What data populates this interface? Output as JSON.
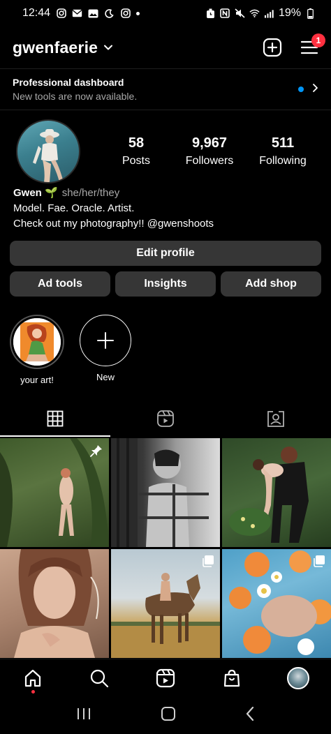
{
  "status_bar": {
    "time": "12:44",
    "battery": "19%"
  },
  "header": {
    "username": "gwenfaerie",
    "notification_count": "1"
  },
  "dashboard": {
    "title": "Professional dashboard",
    "subtitle": "New tools are now available."
  },
  "profile": {
    "stats": [
      {
        "value": "58",
        "label": "Posts"
      },
      {
        "value": "9,967",
        "label": "Followers"
      },
      {
        "value": "511",
        "label": "Following"
      }
    ],
    "name": "Gwen 🌱",
    "pronouns": "she/her/they",
    "bio_line1": "Model. Fae. Oracle. Artist.",
    "bio_line2": "Check out my photography!! @gwenshoots"
  },
  "buttons": {
    "edit_profile": "Edit profile",
    "ad_tools": "Ad tools",
    "insights": "Insights",
    "add_shop": "Add shop"
  },
  "highlights": [
    {
      "label": "your art!"
    },
    {
      "label": "New"
    }
  ],
  "tabs": [
    {
      "icon": "grid-icon",
      "active": true
    },
    {
      "icon": "reels-icon",
      "active": false
    },
    {
      "icon": "tagged-icon",
      "active": false
    }
  ],
  "colors": {
    "accent_blue": "#0095f6",
    "badge_red": "#ff3040",
    "button_bg": "#363636",
    "secondary_text": "#a8a8a8"
  }
}
